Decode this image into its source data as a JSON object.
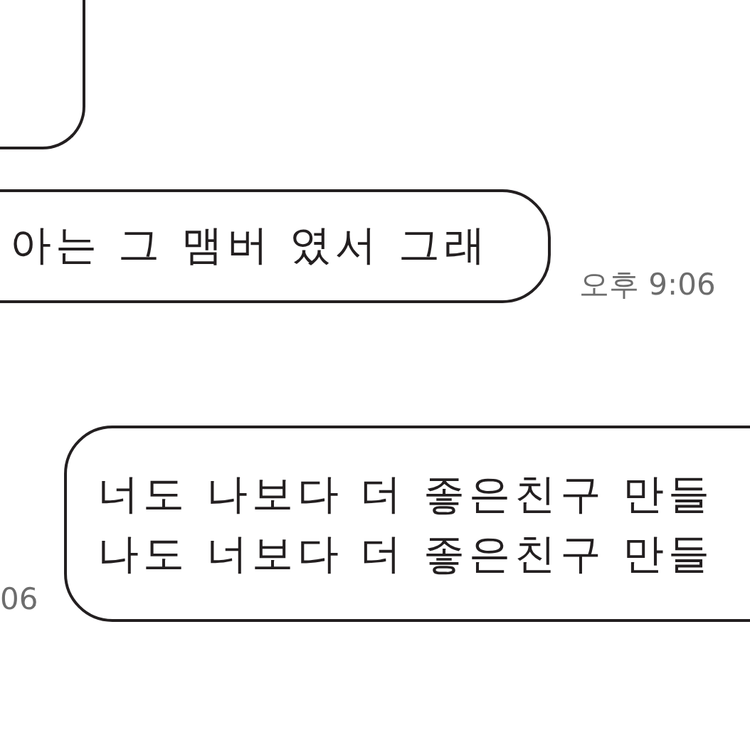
{
  "rows": [
    {
      "kind": "cut_bubble"
    },
    {
      "kind": "bubble_row",
      "parts": [
        {
          "kind": "bubble",
          "lines": [
            "아는 그 맴버 였서 그래"
          ]
        },
        {
          "kind": "time",
          "text": "오후 9:06"
        }
      ]
    },
    {
      "kind": "bubble_row",
      "parts": [
        {
          "kind": "time",
          "text": "06"
        },
        {
          "kind": "bubble",
          "lines": [
            "너도 나보다 더 좋은친구 만들",
            "나도 너보다 더 좋은친구 만들"
          ]
        }
      ]
    }
  ]
}
